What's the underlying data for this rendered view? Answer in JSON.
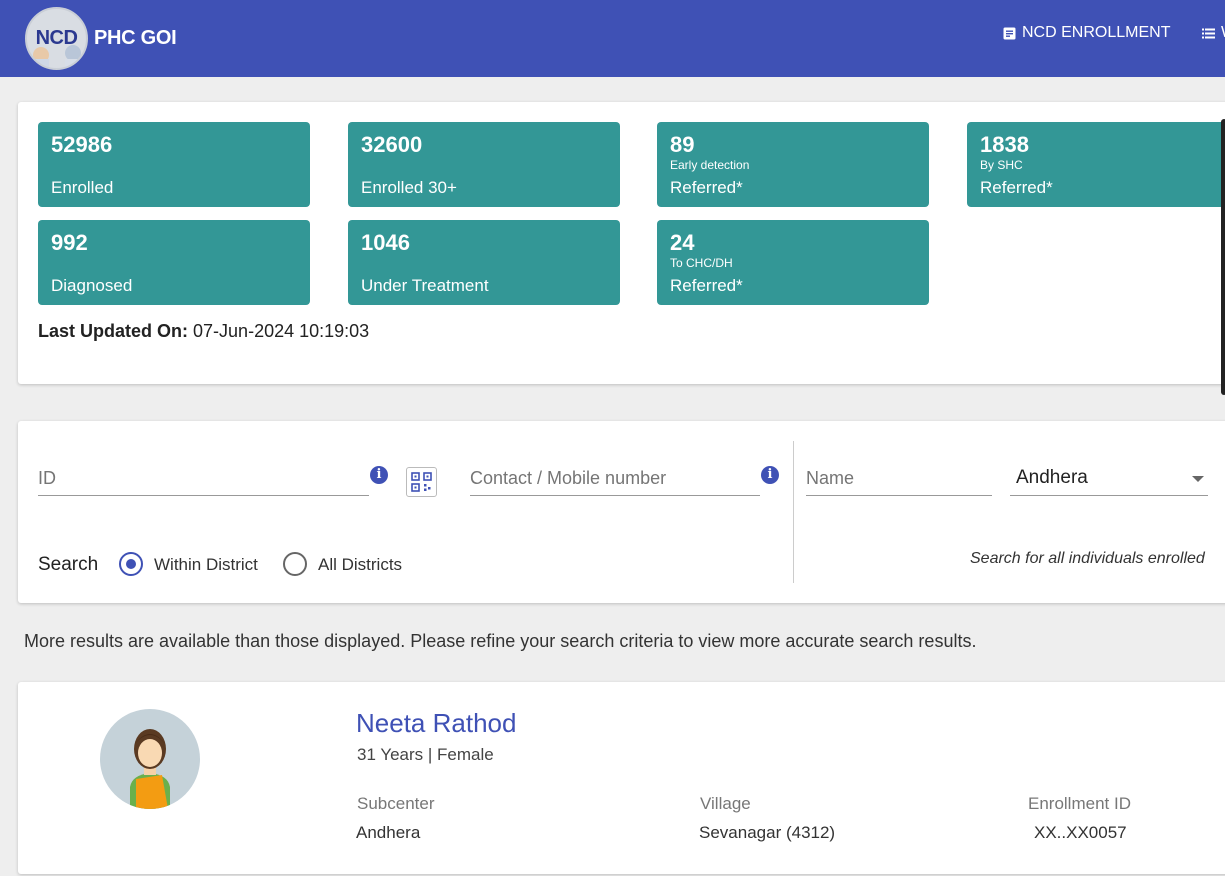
{
  "header": {
    "logo_text": "NCD",
    "app_name": "PHC GOI",
    "nav": [
      {
        "label": "NCD ENROLLMENT",
        "icon": "enrollment-card-icon"
      },
      {
        "label": "W",
        "icon": "menu-list-icon"
      }
    ],
    "brand_color": "#3f51b5"
  },
  "stats": {
    "tile_color": "#339796",
    "tiles": [
      {
        "value": "52986",
        "sub": "",
        "label": "Enrolled"
      },
      {
        "value": "32600",
        "sub": "",
        "label": "Enrolled 30+"
      },
      {
        "value": "89",
        "sub": "Early detection",
        "label": "Referred*"
      },
      {
        "value": "1838",
        "sub": "By SHC",
        "label": "Referred*"
      },
      {
        "value": "992",
        "sub": "",
        "label": "Diagnosed"
      },
      {
        "value": "1046",
        "sub": "",
        "label": "Under Treatment"
      },
      {
        "value": "24",
        "sub": "To CHC/DH",
        "label": "Referred*"
      }
    ],
    "last_updated_label": "Last Updated On:",
    "last_updated_value": "07-Jun-2024 10:19:03"
  },
  "search": {
    "id_placeholder": "ID",
    "contact_placeholder": "Contact / Mobile number",
    "name_placeholder": "Name",
    "subcenter_selected": "Andhera",
    "search_label": "Search",
    "radio_options": [
      {
        "label": "Within District",
        "selected": true
      },
      {
        "label": "All Districts",
        "selected": false
      }
    ],
    "hint": "Search for all individuals enrolled"
  },
  "notice": "More results are available than those displayed. Please refine your search criteria to view more accurate search results.",
  "result": {
    "name": "Neeta Rathod",
    "meta": "31 Years | Female",
    "fields": [
      {
        "label": "Subcenter",
        "value": "Andhera"
      },
      {
        "label": "Village",
        "value": "Sevanagar (4312)"
      },
      {
        "label": "Enrollment ID",
        "value": "XX..XX0057"
      }
    ]
  }
}
